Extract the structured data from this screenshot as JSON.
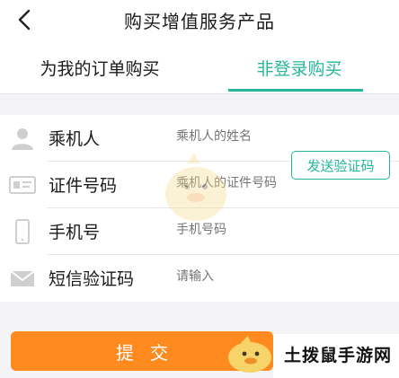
{
  "header": {
    "title": "购买增值服务产品",
    "back_icon": "chevron-left-icon"
  },
  "tabs": [
    {
      "label": "为我的订单购买",
      "active": false
    },
    {
      "label": "非登录购买",
      "active": true
    }
  ],
  "form": {
    "fields": [
      {
        "label": "乘机人",
        "placeholder": "乘机人的姓名",
        "icon": "person-icon"
      },
      {
        "label": "证件号码",
        "placeholder": "乘机人的证件号码",
        "icon": "id-card-icon"
      },
      {
        "label": "手机号",
        "placeholder": "手机号码",
        "icon": "phone-icon"
      },
      {
        "label": "短信验证码",
        "placeholder": "请输入",
        "icon": "envelope-icon"
      }
    ],
    "send_code_label": "发送验证码"
  },
  "submit_label": "提交",
  "watermark": {
    "text": "土拨鼠手游网"
  },
  "colors": {
    "accent": "#26b69b",
    "submit": "#ff8a1f",
    "placeholder": "#b9b9b9",
    "background": "#f4f4f6"
  }
}
